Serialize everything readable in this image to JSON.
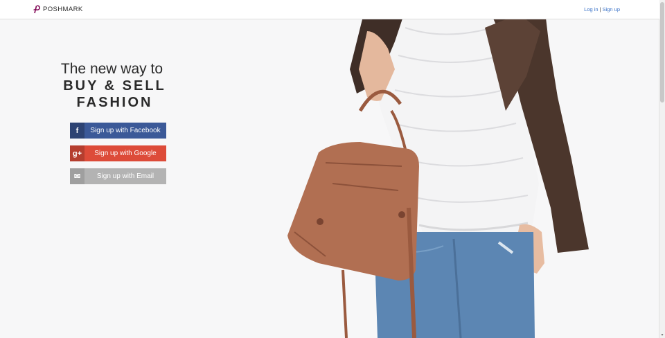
{
  "header": {
    "logo_text": "POSHMARK",
    "login_label": "Log in",
    "separator": "|",
    "signup_label": "Sign up"
  },
  "hero": {
    "line1": "The new way to",
    "line2": "BUY & SELL",
    "line3": "FASHION"
  },
  "buttons": {
    "facebook": {
      "icon": "f",
      "label": "Sign up with Facebook"
    },
    "google": {
      "icon": "g+",
      "label": "Sign up with Google"
    },
    "email": {
      "icon": "✉",
      "label": "Sign up with Email"
    }
  },
  "colors": {
    "facebook": "#3b5998",
    "google": "#dd4b39",
    "email": "#b3b3b3",
    "link": "#3b73c8",
    "brand": "#7f0353"
  },
  "icons": {
    "logo": "poshmark-logo-icon",
    "facebook": "facebook-icon",
    "google": "google-plus-icon",
    "email": "envelope-icon"
  }
}
